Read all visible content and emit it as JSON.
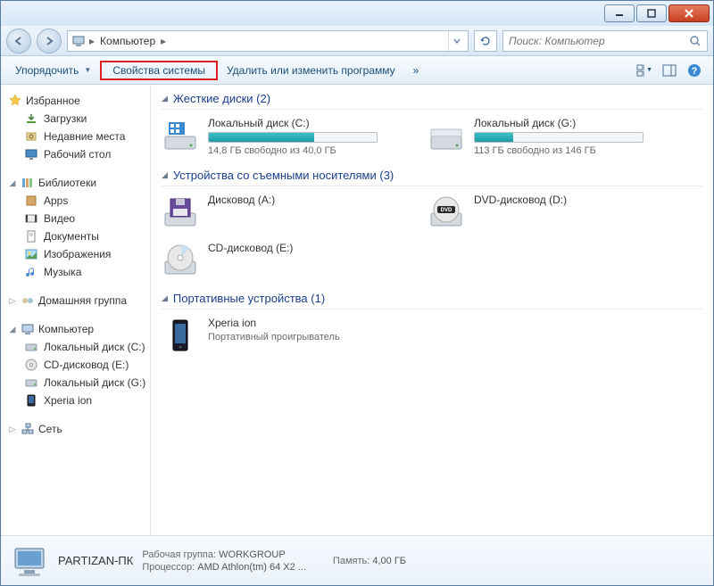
{
  "titlebar": {},
  "nav": {
    "breadcrumb_root_icon": "computer",
    "breadcrumb": "Компьютер",
    "search_placeholder": "Поиск: Компьютер"
  },
  "toolbar": {
    "organize": "Упорядочить",
    "props": "Свойства системы",
    "uninstall": "Удалить или изменить программу",
    "more": "»"
  },
  "sidebar": {
    "favorites": {
      "label": "Избранное",
      "items": [
        {
          "label": "Загрузки",
          "icon": "download"
        },
        {
          "label": "Недавние места",
          "icon": "recent"
        },
        {
          "label": "Рабочий стол",
          "icon": "desktop"
        }
      ]
    },
    "libraries": {
      "label": "Библиотеки",
      "items": [
        {
          "label": "Apps",
          "icon": "apps"
        },
        {
          "label": "Видео",
          "icon": "video"
        },
        {
          "label": "Документы",
          "icon": "docs"
        },
        {
          "label": "Изображения",
          "icon": "images"
        },
        {
          "label": "Музыка",
          "icon": "music"
        }
      ]
    },
    "homegroup": {
      "label": "Домашняя группа"
    },
    "computer": {
      "label": "Компьютер",
      "items": [
        {
          "label": "Локальный диск (C:)",
          "icon": "hdd"
        },
        {
          "label": "CD-дисковод (E:)",
          "icon": "cd"
        },
        {
          "label": "Локальный диск (G:)",
          "icon": "hdd"
        },
        {
          "label": "Xperia ion",
          "icon": "phone"
        }
      ]
    },
    "network": {
      "label": "Сеть"
    }
  },
  "categories": [
    {
      "title": "Жесткие диски (2)",
      "drives": [
        {
          "name": "Локальный диск (C:)",
          "meta": "14,8 ГБ свободно из 40,0 ГБ",
          "fillPct": 63,
          "icon": "hdd-win"
        },
        {
          "name": "Локальный диск (G:)",
          "meta": "113 ГБ свободно из 146 ГБ",
          "fillPct": 23,
          "icon": "hdd"
        }
      ]
    },
    {
      "title": "Устройства со съемными носителями (3)",
      "drives": [
        {
          "name": "Дисковод (A:)",
          "icon": "floppy"
        },
        {
          "name": "DVD-дисковод (D:)",
          "icon": "dvd"
        },
        {
          "name": "CD-дисковод (E:)",
          "icon": "cd-large"
        }
      ]
    },
    {
      "title": "Портативные устройства (1)",
      "drives": [
        {
          "name": "Xperia ion",
          "meta": "Портативный проигрыватель",
          "icon": "phone-large"
        }
      ]
    }
  ],
  "details": {
    "hostname": "PARTIZAN-ПК",
    "workgroup_label": "Рабочая группа:",
    "workgroup": "WORKGROUP",
    "memory_label": "Память:",
    "memory": "4,00 ГБ",
    "cpu_label": "Процессор:",
    "cpu": "AMD Athlon(tm) 64 X2 ..."
  }
}
